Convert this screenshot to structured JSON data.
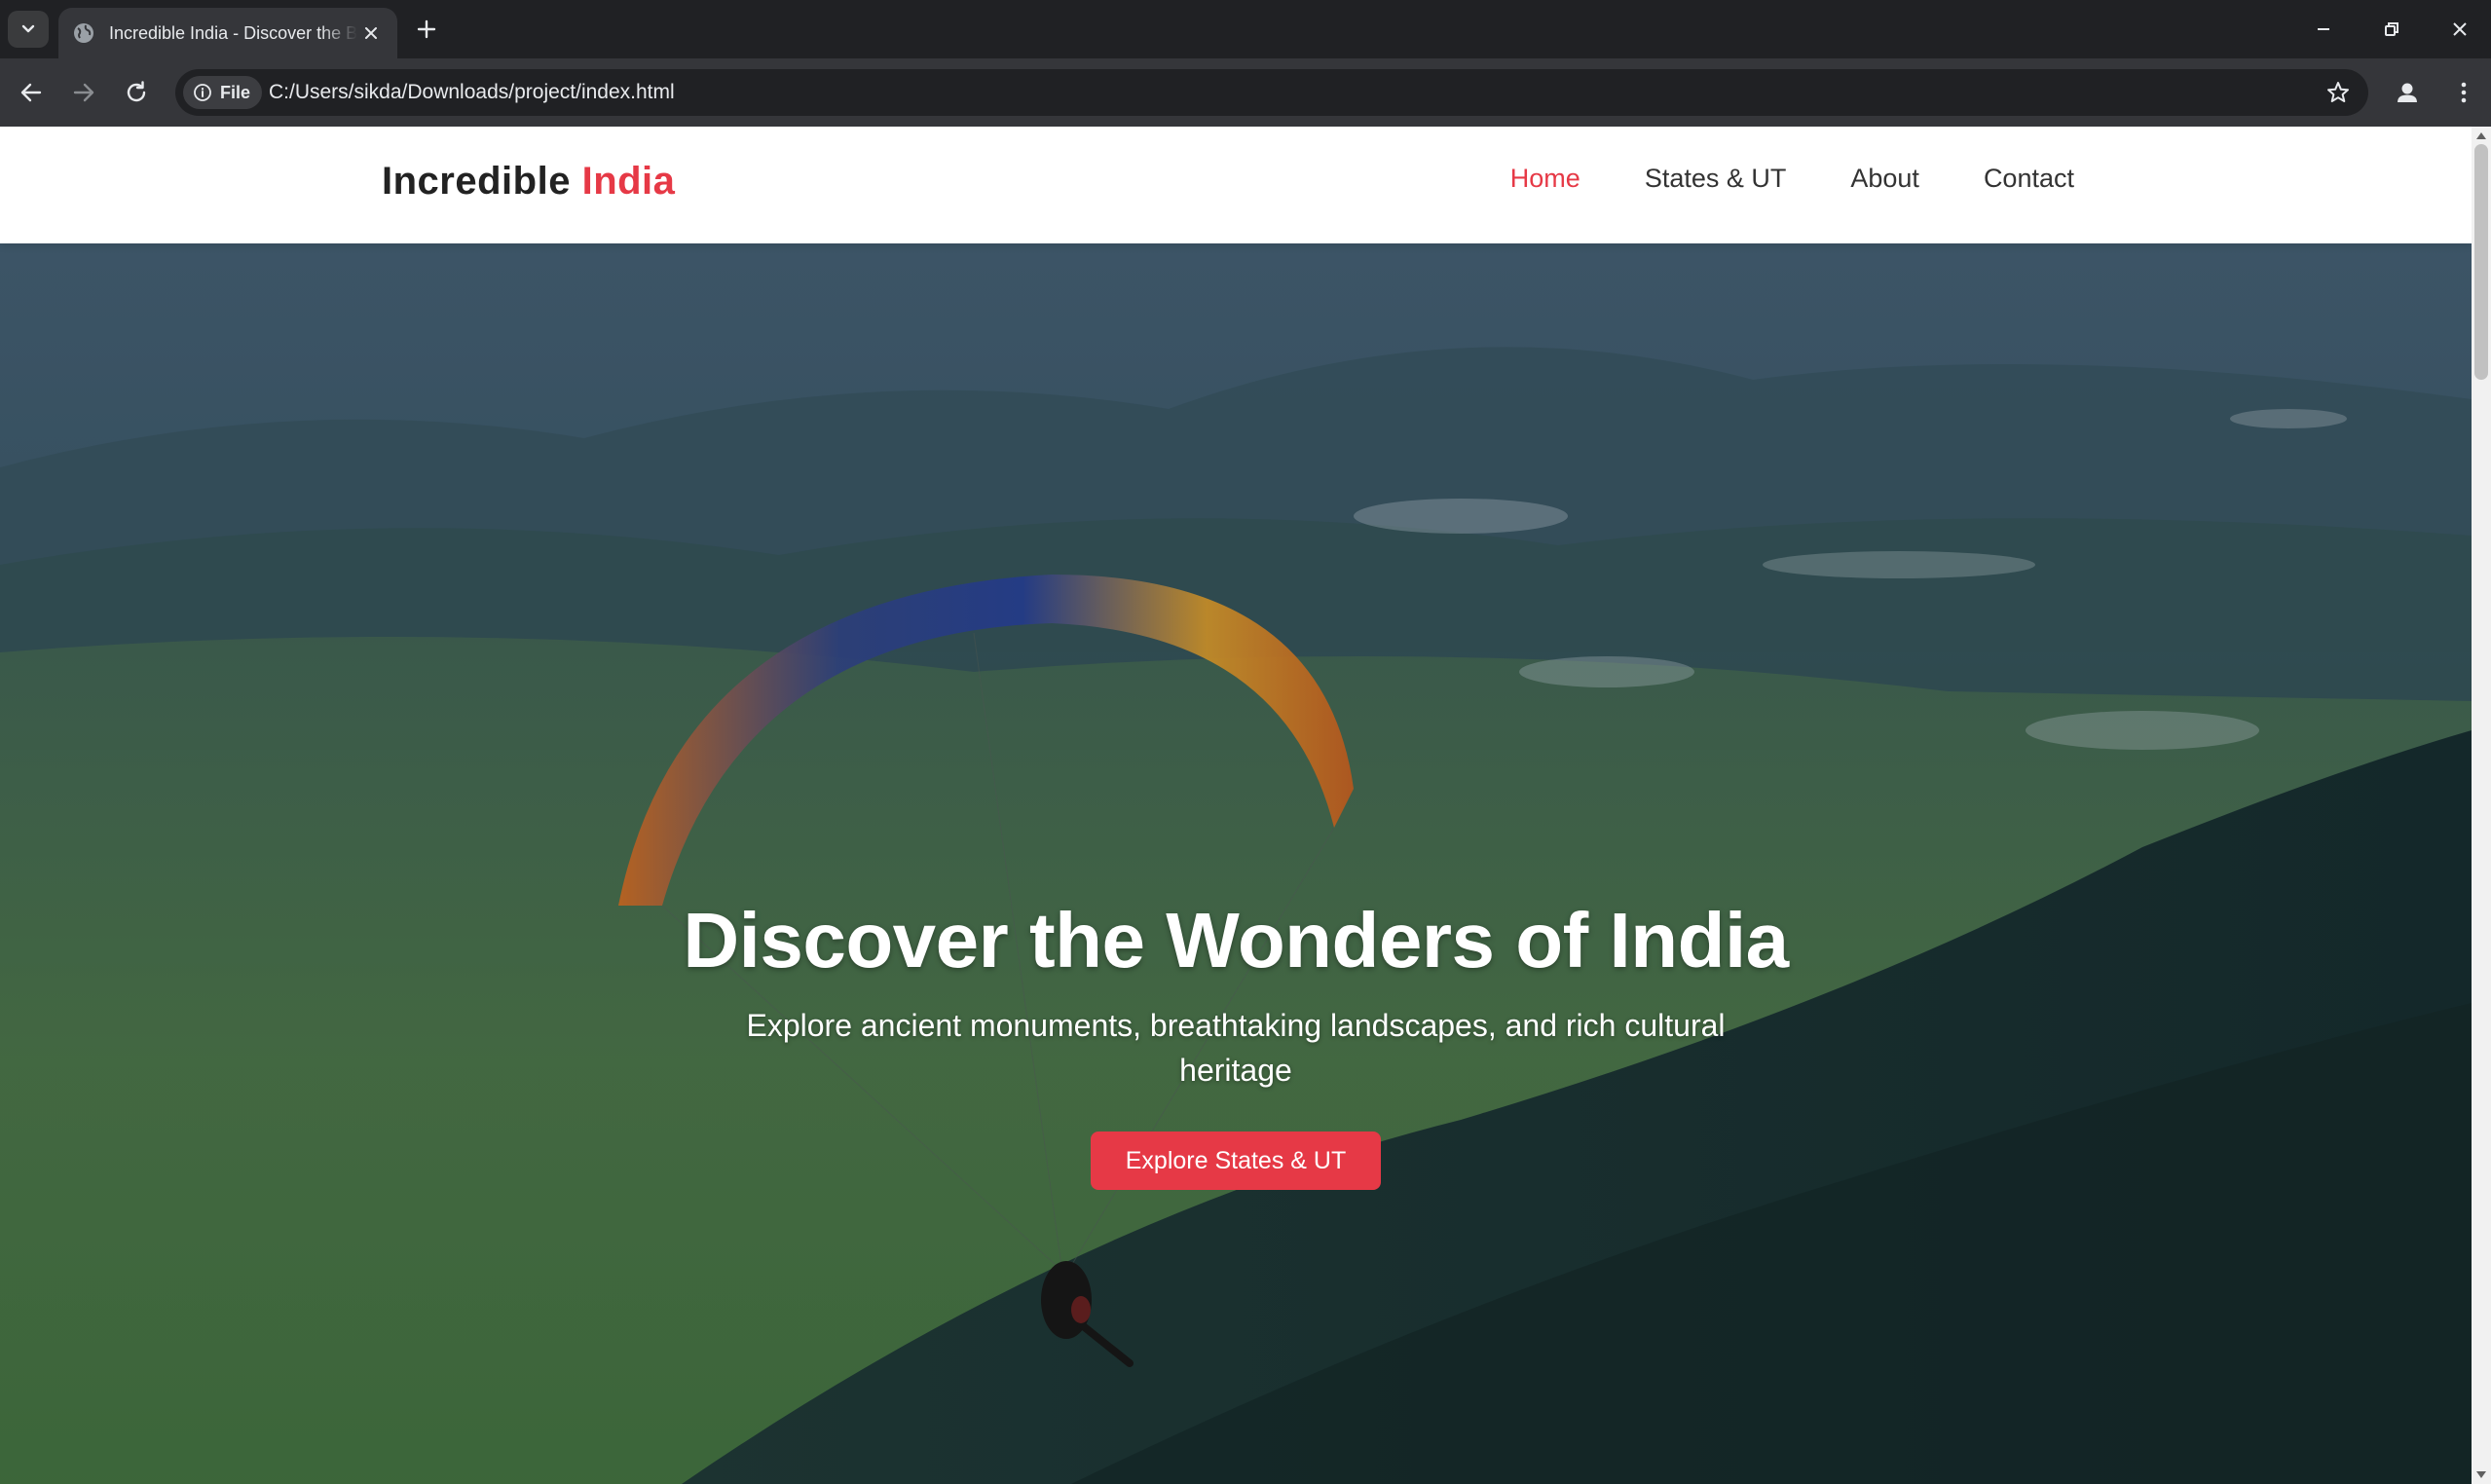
{
  "browser": {
    "tab_title": "Incredible India - Discover the Beauty",
    "url_chip": "File",
    "url": "C:/Users/sikda/Downloads/project/index.html"
  },
  "site": {
    "logo_main": "Incredible",
    "logo_accent": "India",
    "nav": [
      {
        "label": "Home",
        "active": true
      },
      {
        "label": "States & UT",
        "active": false
      },
      {
        "label": "About",
        "active": false
      },
      {
        "label": "Contact",
        "active": false
      }
    ]
  },
  "hero": {
    "title": "Discover the Wonders of India",
    "subtitle": "Explore ancient monuments, breathtaking landscapes, and rich cultural heritage",
    "cta": "Explore States & UT"
  },
  "colors": {
    "accent": "#e63946",
    "chrome_dark": "#202124",
    "chrome_toolbar": "#35363a"
  }
}
